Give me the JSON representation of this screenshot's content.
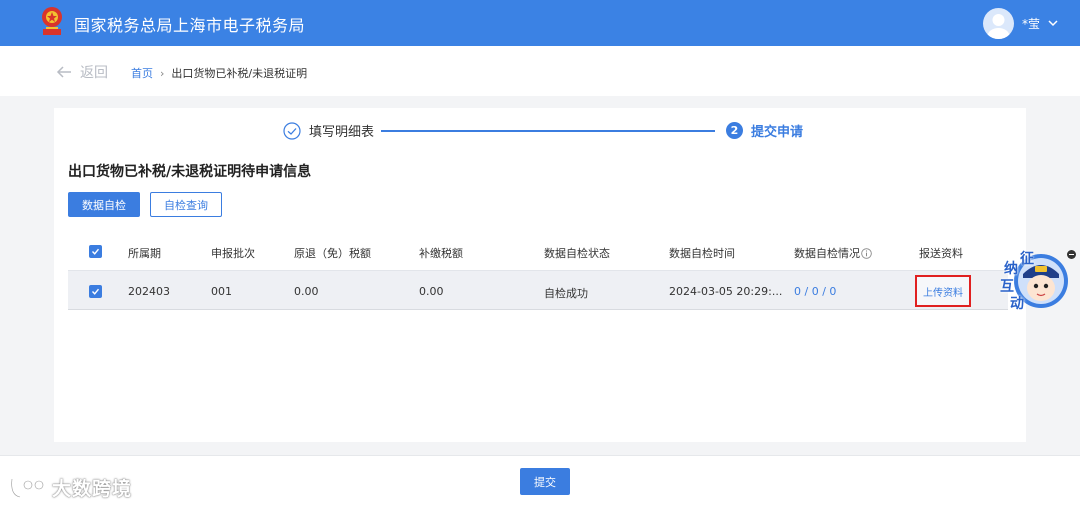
{
  "header": {
    "title": "国家税务总局上海市电子税务局",
    "user_name": "*莹"
  },
  "nav": {
    "back_label": "返回",
    "breadcrumb": {
      "home": "首页",
      "separator": "›",
      "current": "出口货物已补税/未退税证明"
    }
  },
  "steps": [
    {
      "label": "填写明细表",
      "status": "done"
    },
    {
      "number": "2",
      "label": "提交申请",
      "status": "active"
    }
  ],
  "section": {
    "title": "出口货物已补税/未退税证明待申请信息"
  },
  "buttons": {
    "self_check": "数据自检",
    "check_query": "自检查询",
    "submit": "提交"
  },
  "table": {
    "columns": [
      "所属期",
      "申报批次",
      "原退（免）税额",
      "补缴税额",
      "数据自检状态",
      "数据自检时间",
      "数据自检情况",
      "报送资料"
    ],
    "rows": [
      {
        "period": "202403",
        "batch": "001",
        "refund_amount": "0.00",
        "supplement_tax": "0.00",
        "check_status": "自检成功",
        "check_time": "2024-03-05 20:29:...",
        "check_result": "0 / 0 / 0",
        "upload_link": "上传资料"
      }
    ]
  },
  "chat_widget": {
    "chars": [
      "征",
      "纳",
      "互",
      "动"
    ]
  },
  "watermark": {
    "text": "大数跨境"
  },
  "colors": {
    "header_bg": "#3b82e4",
    "accent": "#3b7de0",
    "highlight_border": "#e02020"
  }
}
